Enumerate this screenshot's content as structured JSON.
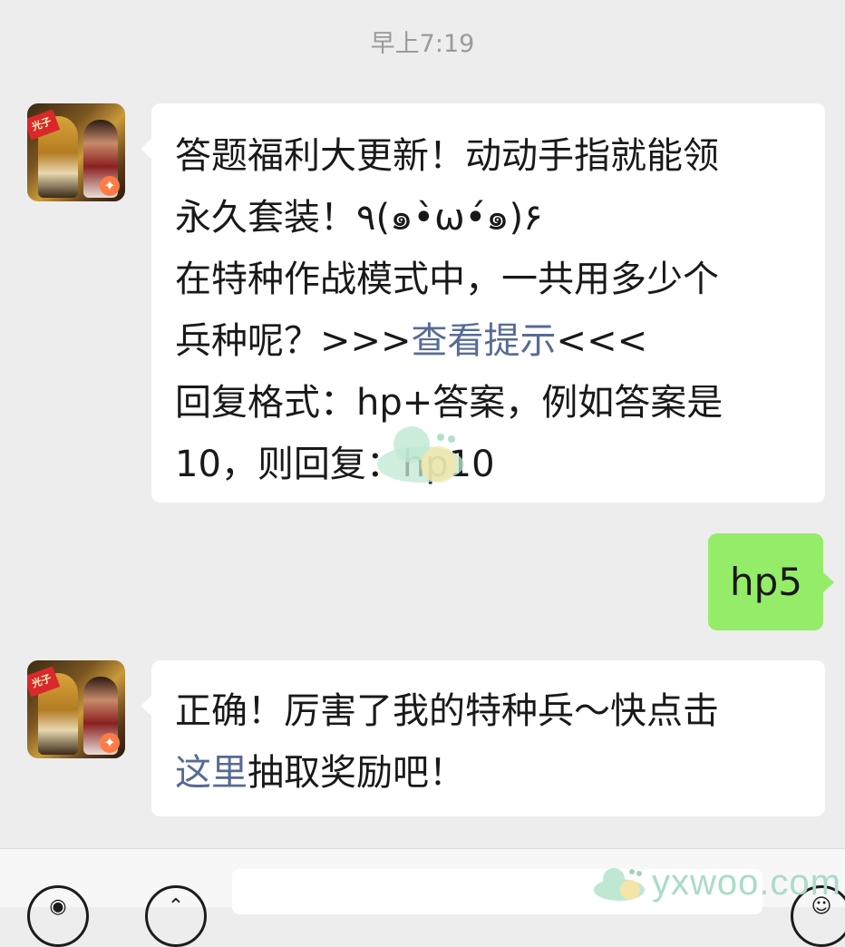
{
  "chat": {
    "timestamp": "早上7:19",
    "messages": [
      {
        "sender": "bot",
        "lines": [
          [
            {
              "text": "答题福利大更新！动动手指就能领"
            }
          ],
          [
            {
              "text": "永久套装！٩(๑•̀ω•́๑)۶"
            }
          ],
          [
            {
              "text": "在特种作战模式中，一共用多少个"
            }
          ],
          [
            {
              "text": "兵种呢？>>>"
            },
            {
              "text": "查看提示",
              "link": true
            },
            {
              "text": "<<<"
            }
          ],
          [
            {
              "text": "回复格式：hp+答案，例如答案是"
            }
          ],
          [
            {
              "text": "10，则回复：hp10"
            }
          ]
        ]
      },
      {
        "sender": "user",
        "text": "hp5"
      },
      {
        "sender": "bot",
        "lines": [
          [
            {
              "text": "正确！厉害了我的特种兵～快点击"
            }
          ],
          [
            {
              "text": "这里",
              "link": true
            },
            {
              "text": "抽取奖励吧！"
            }
          ]
        ]
      }
    ],
    "avatar_badge": "光子"
  },
  "watermark": {
    "text": "yxwoo.com"
  },
  "colors": {
    "background": "#ededed",
    "bubble_incoming": "#ffffff",
    "bubble_outgoing": "#95ec69",
    "link": "#576b95",
    "timestamp": "#9a9a9a"
  }
}
